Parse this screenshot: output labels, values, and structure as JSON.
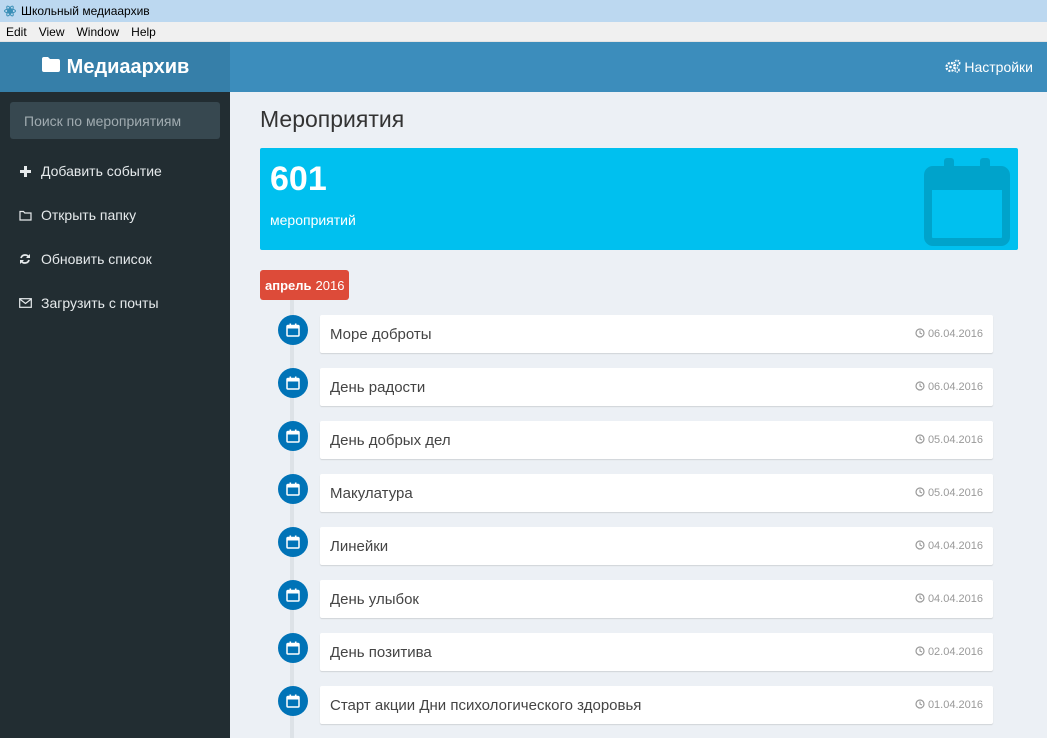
{
  "window": {
    "title": "Школьный медиаархив"
  },
  "menu": [
    "Edit",
    "View",
    "Window",
    "Help"
  ],
  "header": {
    "brand": "Медиаархив",
    "settings": "Настройки"
  },
  "sidebar": {
    "search_placeholder": "Поиск по мероприятиям",
    "items": [
      {
        "label": "Добавить событие",
        "icon": "plus-icon"
      },
      {
        "label": "Открыть папку",
        "icon": "folder-open-icon"
      },
      {
        "label": "Обновить список",
        "icon": "refresh-icon"
      },
      {
        "label": "Загрузить с почты",
        "icon": "envelope-icon"
      }
    ]
  },
  "main": {
    "title": "Мероприятия",
    "stats": {
      "count": "601",
      "label": "мероприятий"
    },
    "month": {
      "name": "апрель",
      "year": "2016"
    },
    "events": [
      {
        "title": "Море доброты",
        "date": "06.04.2016"
      },
      {
        "title": "День радости",
        "date": "06.04.2016"
      },
      {
        "title": "День добрых дел",
        "date": "05.04.2016"
      },
      {
        "title": "Макулатура",
        "date": "05.04.2016"
      },
      {
        "title": "Линейки",
        "date": "04.04.2016"
      },
      {
        "title": "День улыбок",
        "date": "04.04.2016"
      },
      {
        "title": "День позитива",
        "date": "02.04.2016"
      },
      {
        "title": "Старт акции Дни психологического здоровья",
        "date": "01.04.2016"
      }
    ]
  },
  "colors": {
    "header_left": "#367fa9",
    "header_right": "#3c8dbc",
    "sidebar": "#222d32",
    "infobox": "#00c0ef",
    "month_badge": "#dd4b39",
    "timeline_icon": "#0073b7"
  }
}
